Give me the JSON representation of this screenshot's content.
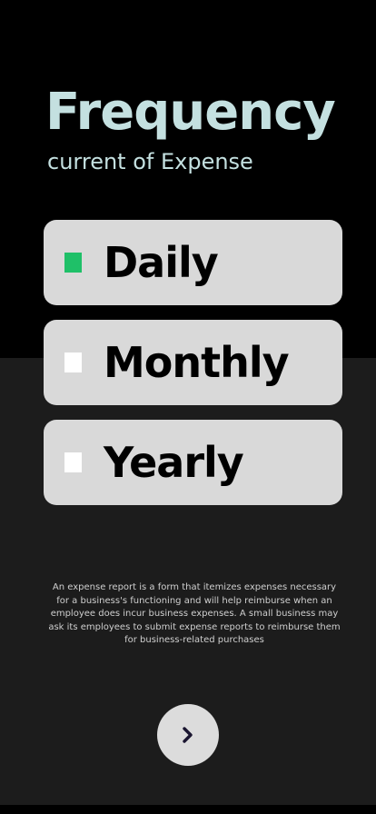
{
  "header": {
    "title": "Frequency",
    "subtitle": "current of Expense"
  },
  "options": [
    {
      "label": "Daily",
      "selected": true
    },
    {
      "label": "Monthly",
      "selected": false
    },
    {
      "label": "Yearly",
      "selected": false
    }
  ],
  "description": "An expense report is a form that itemizes expenses necessary for a business's functioning and will help reimburse when an employee does incur business expenses. A small business may ask its employees to submit expense reports to reimburse them for business-related purchases",
  "next_button": {
    "icon": "chevron-right-icon"
  },
  "colors": {
    "title": "#c4e0e0",
    "selected_check": "#1fc068",
    "unselected_check": "#ffffff",
    "option_bg": "#d9d9d9",
    "top_bg": "#000000",
    "bottom_bg": "#1c1c1c",
    "chevron": "#1a1530"
  }
}
